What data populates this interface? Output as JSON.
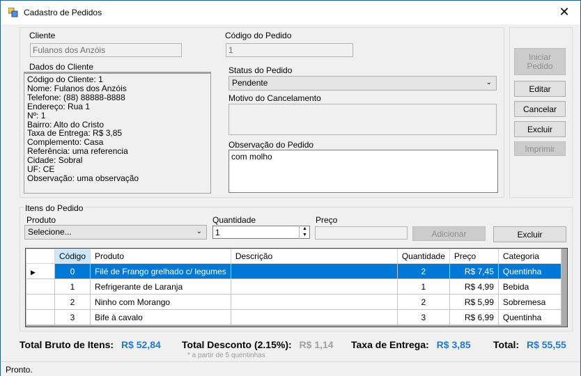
{
  "window": {
    "title": "Cadastro de Pedidos",
    "close_glyph": "✕"
  },
  "client": {
    "label": "Cliente",
    "value": "Fulanos dos Anzóis",
    "details_label": "Dados do Cliente",
    "details": [
      "Código do Cliente: 1",
      "Nome: Fulanos dos Anzóis",
      "Telefone: (88) 88888-8888",
      "Endereço: Rua 1",
      "Nº: 1",
      "Bairro: Alto do Cristo",
      "Taxa de Entrega: R$ 3,85",
      "Complemento: Casa",
      "Referência: uma referencia",
      "Cidade: Sobral",
      "UF: CE",
      "Observação: uma observação"
    ]
  },
  "order": {
    "code_label": "Código do Pedido",
    "code_value": "1",
    "status_label": "Status do Pedido",
    "status_value": "Pendente",
    "cancel_reason_label": "Motivo do Cancelamento",
    "cancel_reason_value": "",
    "observation_label": "Observação do Pedido",
    "observation_value": "com molho"
  },
  "actions": {
    "start_order": "Iniciar Pedido",
    "edit": "Editar",
    "cancel": "Cancelar",
    "delete": "Excluir",
    "print": "Imprimir"
  },
  "items": {
    "group_label": "Itens do Pedido",
    "product_label": "Produto",
    "product_value": "Selecione...",
    "quantity_label": "Quantidade",
    "quantity_value": "1",
    "price_label": "Preço",
    "price_value": "",
    "add_button": "Adicionar",
    "delete_button": "Excluir",
    "columns": [
      "Código",
      "Produto",
      "Descrição",
      "Quantidade",
      "Preço",
      "Categoria"
    ],
    "rows": [
      {
        "code": "0",
        "product": "Filé de Frango grelhado c/ legumes",
        "description": "",
        "quantity": "2",
        "price": "R$ 7,45",
        "category": "Quentinha"
      },
      {
        "code": "1",
        "product": "Refrigerante de Laranja",
        "description": "",
        "quantity": "1",
        "price": "R$ 4,99",
        "category": "Bebida"
      },
      {
        "code": "2",
        "product": "Ninho com Morango",
        "description": "",
        "quantity": "2",
        "price": "R$ 5,99",
        "category": "Sobremesa"
      },
      {
        "code": "3",
        "product": "Bife à cavalo",
        "description": "",
        "quantity": "3",
        "price": "R$ 6,99",
        "category": "Quentinha"
      }
    ]
  },
  "totals": {
    "gross_label": "Total Bruto de Itens:",
    "gross_value": "R$ 52,84",
    "discount_label": "Total Desconto (2.15%):",
    "discount_value": "R$ 1,14",
    "discount_note": "* a partir de 5 quentinhas",
    "delivery_label": "Taxa de Entrega:",
    "delivery_value": "R$ 3,85",
    "total_label": "Total:",
    "total_value": "R$ 55,55"
  },
  "status_bar": {
    "text": "Pronto."
  },
  "colors": {
    "accent": "#0078d7",
    "total_blue": "#1e7ad6",
    "disabled_grey": "#a0a0a0"
  }
}
